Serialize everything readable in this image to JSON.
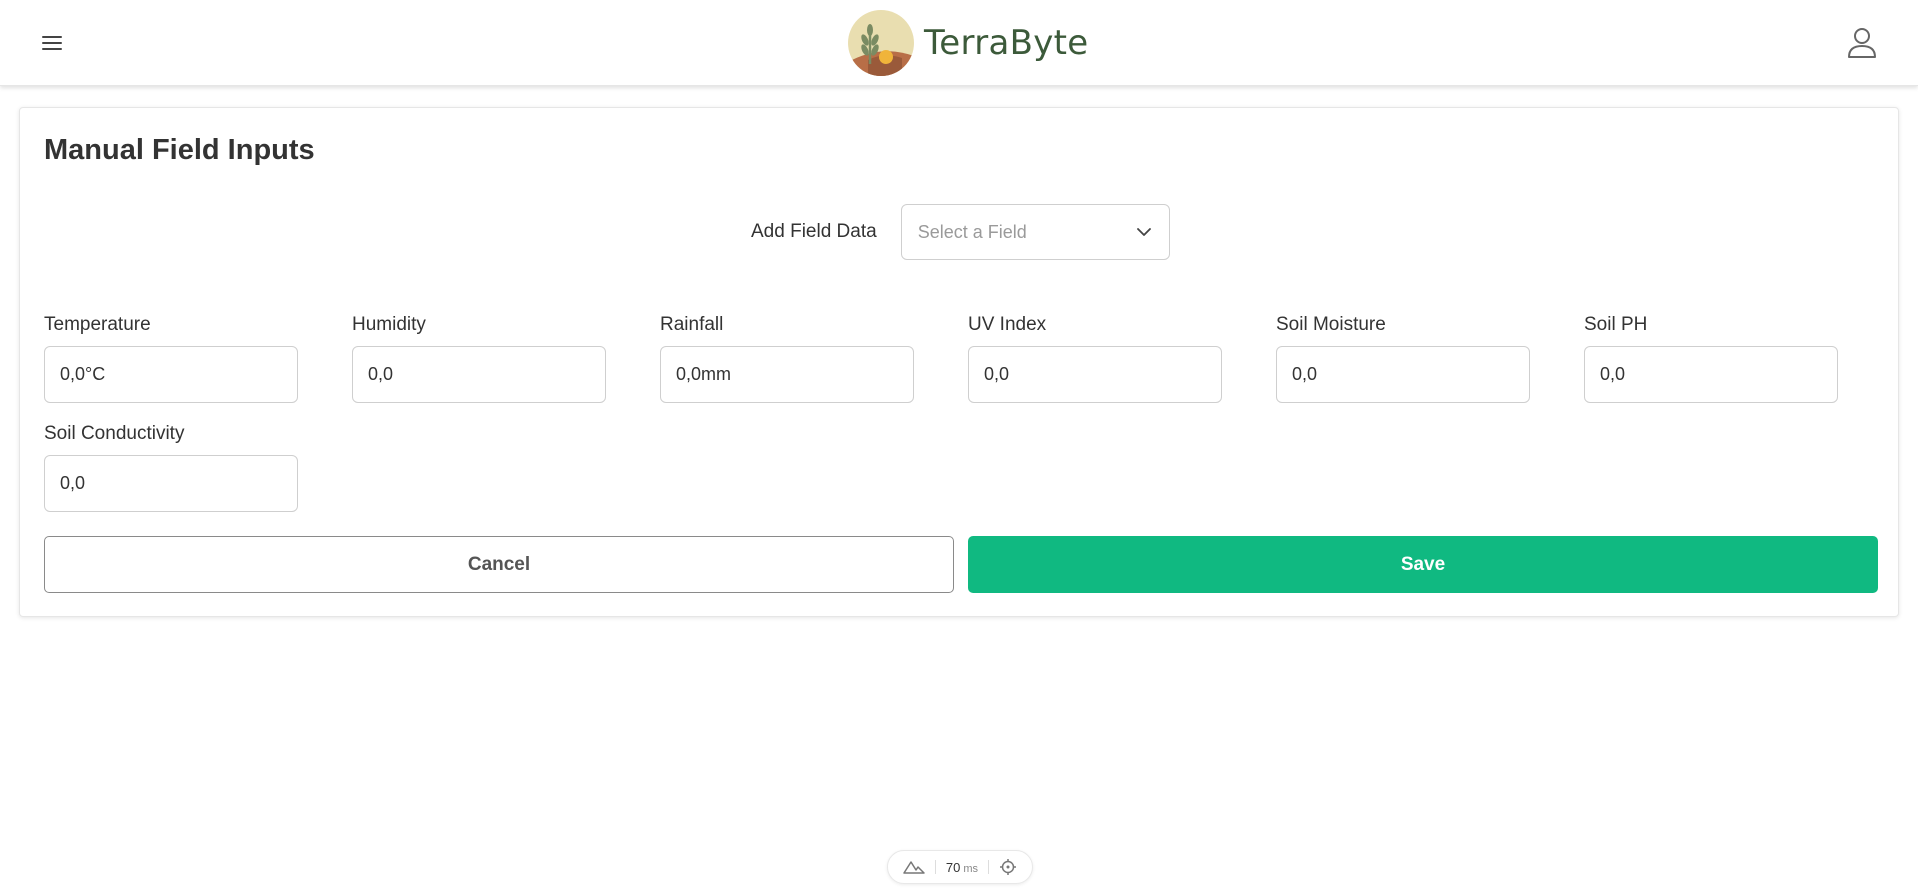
{
  "header": {
    "app_name": "TerraByte",
    "menu_icon": "hamburger-menu-icon",
    "user_icon": "user-profile-icon"
  },
  "page": {
    "title": "Manual Field Inputs"
  },
  "field_select": {
    "label": "Add Field Data",
    "placeholder": "Select a Field"
  },
  "inputs": [
    {
      "label": "Temperature",
      "value": "0,0°C"
    },
    {
      "label": "Humidity",
      "value": "0,0"
    },
    {
      "label": "Rainfall",
      "value": "0,0mm"
    },
    {
      "label": "UV Index",
      "value": "0,0"
    },
    {
      "label": "Soil Moisture",
      "value": "0,0"
    },
    {
      "label": "Soil PH",
      "value": "0,0"
    },
    {
      "label": "Soil Conductivity",
      "value": "0,0"
    }
  ],
  "actions": {
    "cancel_label": "Cancel",
    "save_label": "Save"
  },
  "dev_toolbar": {
    "timing_value": "70",
    "timing_unit": "ms"
  },
  "colors": {
    "accent": "#10b981",
    "logo_text": "#3c5a3a"
  }
}
